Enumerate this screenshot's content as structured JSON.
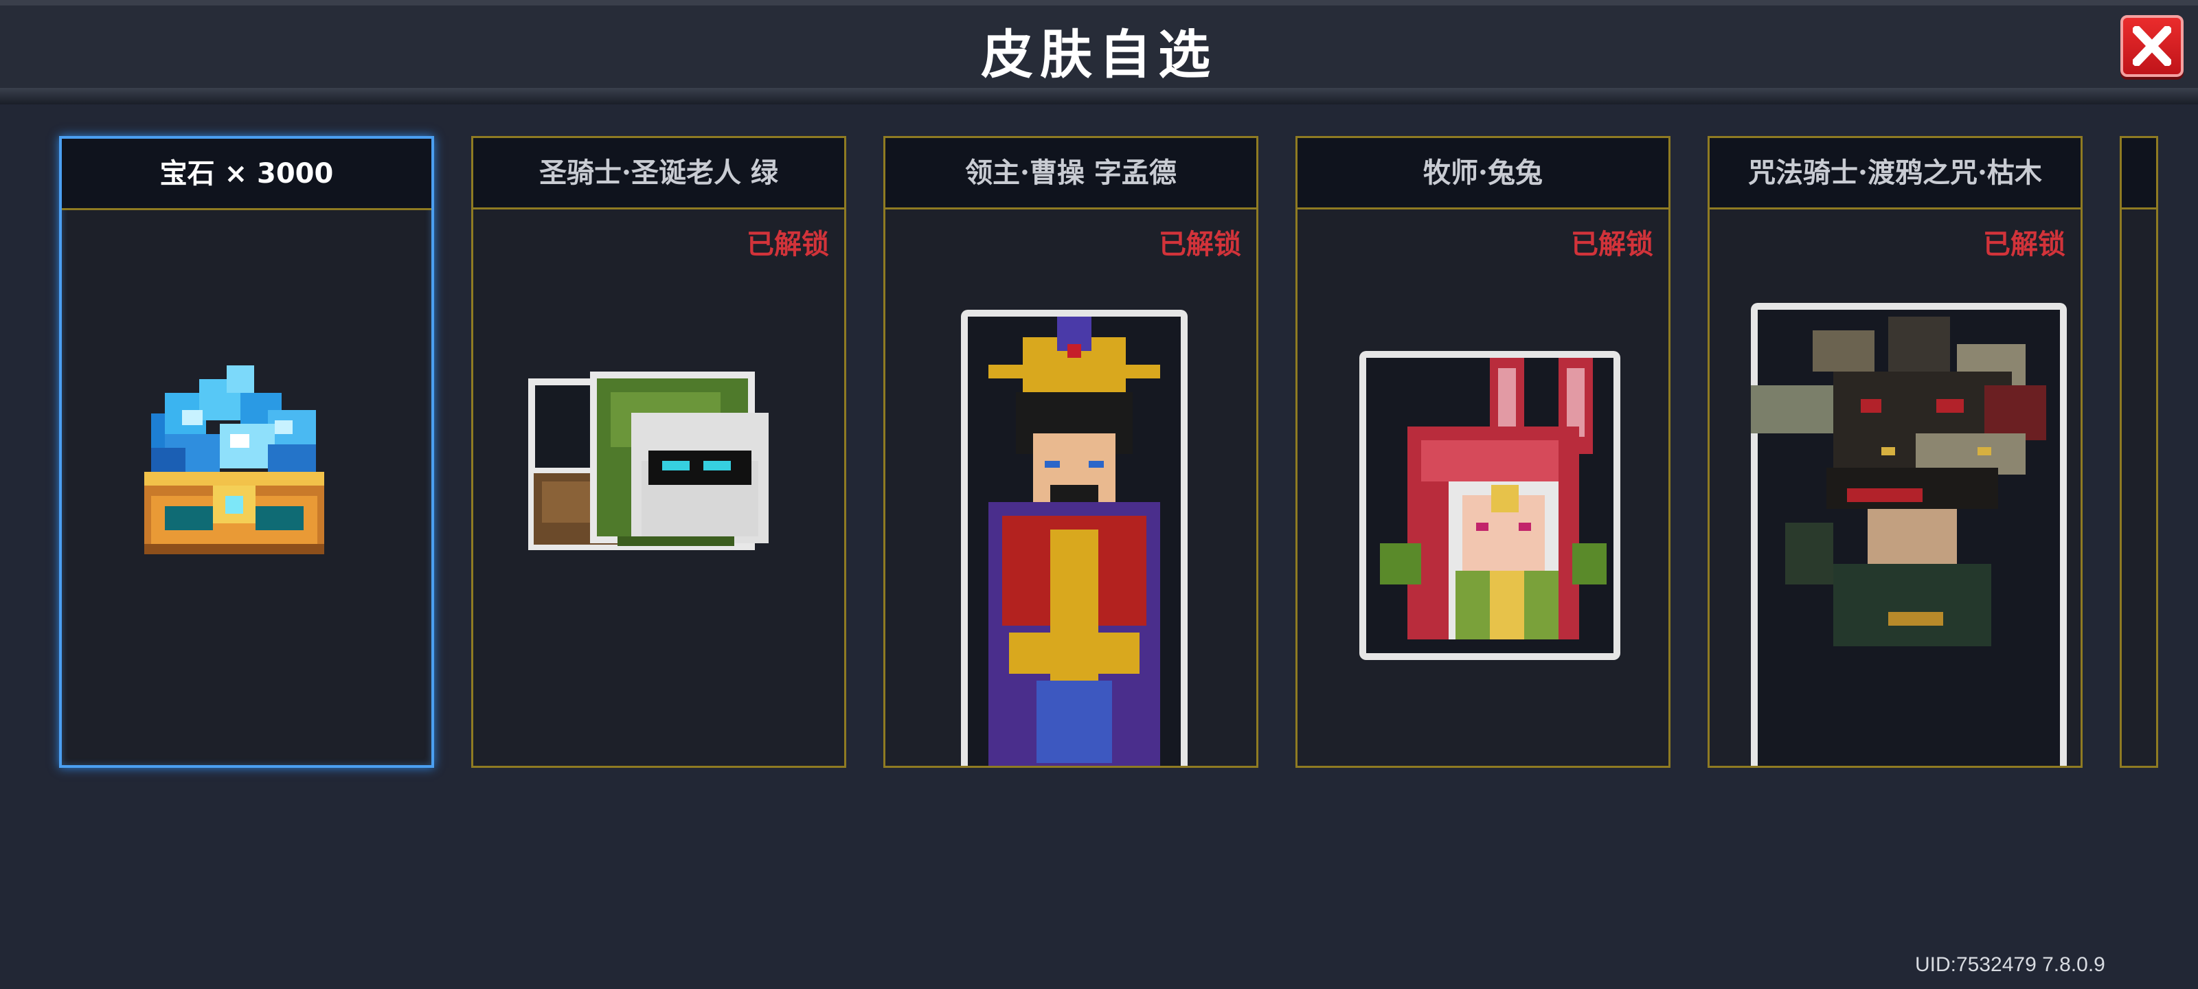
{
  "header": {
    "title": "皮肤自选",
    "close_icon": "close-icon"
  },
  "cards": [
    {
      "title": "宝石 × 3000",
      "unlocked": "",
      "icon": "gem-chest-icon",
      "selected": true
    },
    {
      "title": "圣骑士·圣诞老人 绿",
      "unlocked": "已解锁",
      "icon": "paladin-santa-green-portrait"
    },
    {
      "title": "领主·曹操 字孟德",
      "unlocked": "已解锁",
      "icon": "lord-cao-cao-portrait"
    },
    {
      "title": "牧师·兔兔",
      "unlocked": "已解锁",
      "icon": "priest-bunny-portrait"
    },
    {
      "title": "咒法骑士·渡鸦之咒·枯木",
      "unlocked": "已解锁",
      "icon": "spell-knight-raven-curse-portrait"
    }
  ],
  "footer": {
    "uid": "UID:7532479 7.8.0.9"
  },
  "colors": {
    "background": "#222735",
    "card_border": "#8f7b22",
    "selected_border": "#4b9ff1",
    "unlocked_text": "#d2333a",
    "close_button": "#d81e22"
  }
}
